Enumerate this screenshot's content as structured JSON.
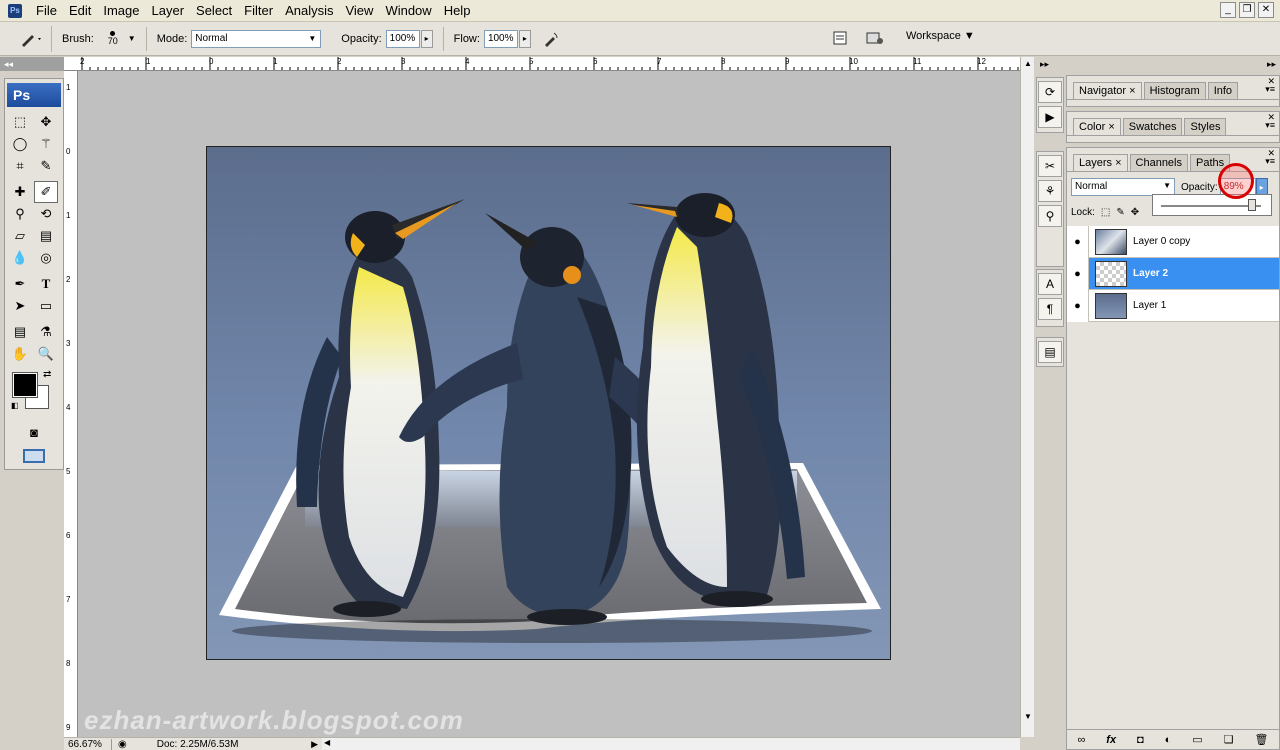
{
  "app": {
    "menu": [
      "File",
      "Edit",
      "Image",
      "Layer",
      "Select",
      "Filter",
      "Analysis",
      "View",
      "Window",
      "Help"
    ],
    "logo_text": "Ps"
  },
  "window_controls": {
    "minimize": "_",
    "restore": "❐",
    "close": "✕"
  },
  "options_bar": {
    "brush_label": "Brush:",
    "brush_size": "70",
    "mode_label": "Mode:",
    "mode_value": "Normal",
    "opacity_label": "Opacity:",
    "opacity_value": "100%",
    "flow_label": "Flow:",
    "flow_value": "100%",
    "workspace_label": "Workspace"
  },
  "toolbox": {
    "header": "◂◂",
    "badge": "Ps"
  },
  "rulers": {
    "top_labels": [
      "2",
      "1",
      "0",
      "1",
      "2",
      "3",
      "4",
      "5",
      "6",
      "7",
      "8",
      "9",
      "10",
      "11",
      "12"
    ],
    "left_labels": [
      "1",
      "0",
      "1",
      "2",
      "3",
      "4",
      "5",
      "6",
      "7",
      "8",
      "9"
    ]
  },
  "canvas": {
    "watermark": "ezhan-artwork.blogspot.com"
  },
  "status": {
    "zoom": "66.67%",
    "doc": "Doc: 2.25M/6.53M"
  },
  "panels": {
    "navigator_tabs": [
      "Navigator",
      "Histogram",
      "Info"
    ],
    "color_tabs": [
      "Color",
      "Swatches",
      "Styles"
    ],
    "layers_tabs": [
      "Layers",
      "Channels",
      "Paths"
    ],
    "blend_mode": "Normal",
    "opacity_label": "Opacity:",
    "opacity_value": "89%",
    "lock_label": "Lock:",
    "layers": [
      {
        "name": "Layer 0 copy",
        "selected": false
      },
      {
        "name": "Layer 2",
        "selected": true
      },
      {
        "name": "Layer 1",
        "selected": false
      }
    ],
    "footer_icons": [
      "link",
      "fx",
      "mask",
      "adjustment",
      "group",
      "new-layer",
      "trash"
    ]
  },
  "colors": {
    "selection": "#3a90f0",
    "highlight_circle": "#d80000"
  }
}
